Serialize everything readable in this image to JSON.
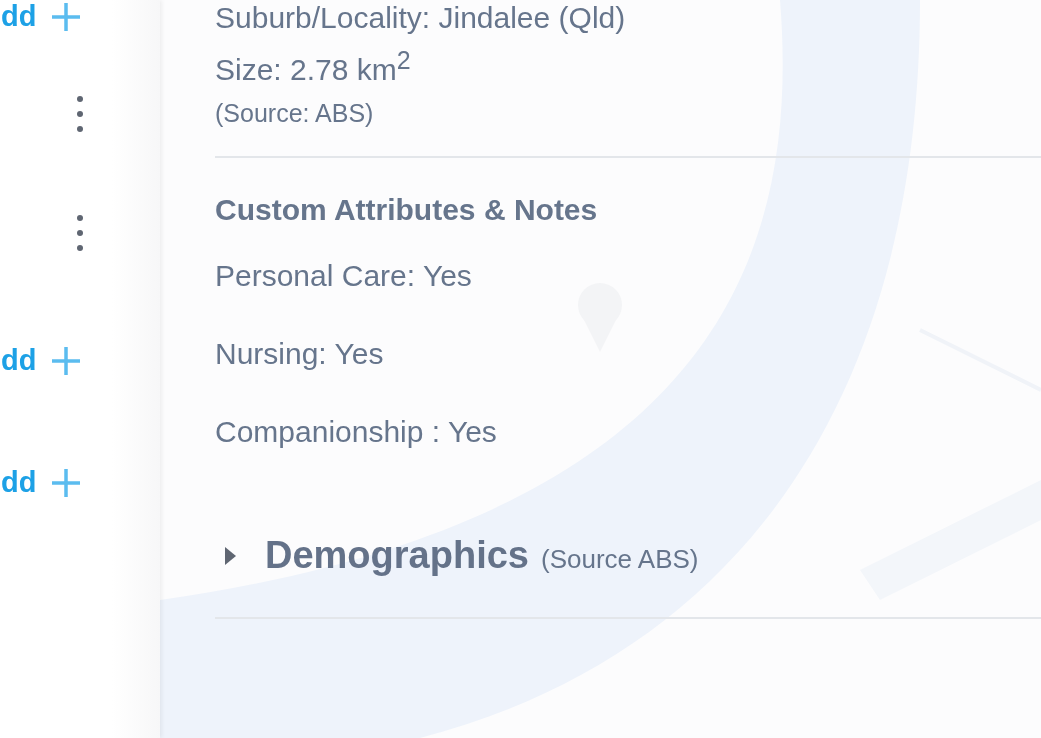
{
  "left_actions": [
    {
      "kind": "add",
      "label": "dd"
    },
    {
      "kind": "more"
    },
    {
      "kind": "more"
    },
    {
      "kind": "add",
      "label": "dd"
    },
    {
      "kind": "add",
      "label": "dd"
    }
  ],
  "details": {
    "locality": "Suburb/Locality: Jindalee (Qld)",
    "size": "Size: 2.78 km$^{2}$",
    "source": "(Source: ABS)"
  },
  "custom_attributes": {
    "title": "Custom Attributes & Notes",
    "items": [
      "Personal Care: Yes",
      "Nursing: Yes",
      "Companionship : Yes"
    ]
  },
  "demographics": {
    "title": "Demographics",
    "source": "(Source ABS)",
    "expanded": false
  }
}
